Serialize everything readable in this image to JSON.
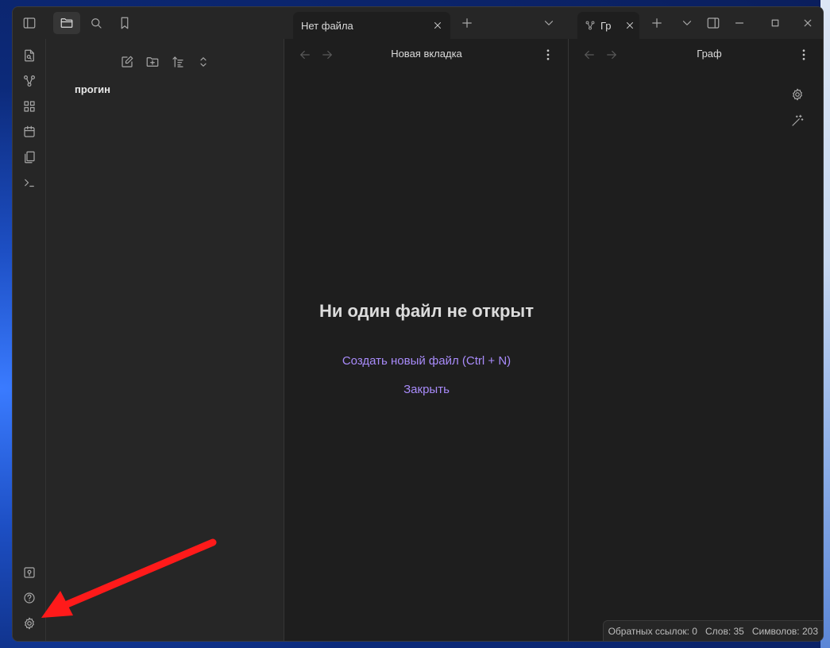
{
  "titlebar": {
    "left_icons": [
      "sidebar-toggle-icon",
      "folder-icon",
      "search-icon",
      "bookmark-icon"
    ],
    "tab_main": {
      "label": "Нет файла"
    },
    "tab_graph": {
      "label": "Гр"
    },
    "window_controls": [
      "minimize-icon",
      "maximize-icon",
      "close-icon"
    ]
  },
  "ribbon": {
    "top_icons": [
      "quick-switcher-icon",
      "graph-view-icon",
      "canvas-icon",
      "daily-note-icon",
      "templates-icon",
      "command-palette-icon"
    ],
    "bottom_icons": [
      "vault-switcher-icon",
      "help-icon",
      "settings-icon"
    ]
  },
  "sidebar": {
    "toolbar_icons": [
      "new-note-icon",
      "new-folder-icon",
      "sort-icon",
      "collapse-icon"
    ],
    "vault_name": "прогин"
  },
  "main_pane": {
    "header_title": "Новая вкладка",
    "empty_title": "Ни один файл не открыт",
    "create_link": "Создать новый файл (Ctrl + N)",
    "close_link": "Закрыть"
  },
  "graph_pane": {
    "header_title": "Граф"
  },
  "statusbar": {
    "backlinks": "Обратных ссылок: 0",
    "words": "Слов: 35",
    "chars": "Символов: 203"
  },
  "colors": {
    "accent_link": "#a88bfa",
    "annotation_arrow": "#ff1a1a",
    "background": "#1e1e1e",
    "panel": "#262626"
  }
}
